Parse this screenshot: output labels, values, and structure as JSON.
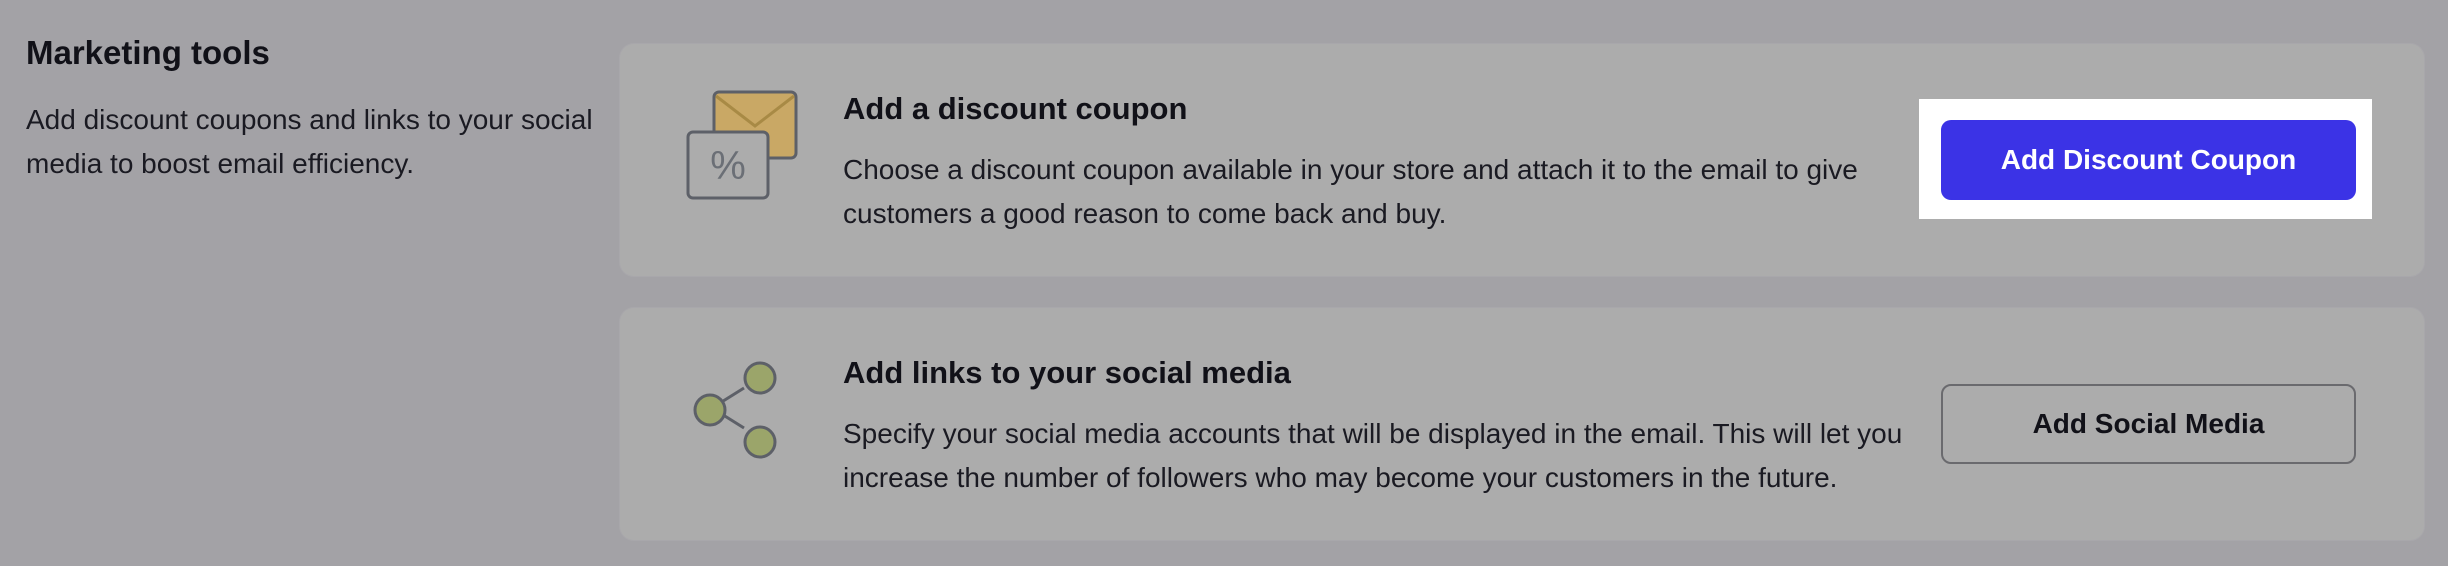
{
  "section": {
    "title": "Marketing tools",
    "description": "Add discount coupons and links to your social media to boost email efficiency."
  },
  "cards": {
    "coupon": {
      "icon": "envelope-percent-icon",
      "title": "Add a discount coupon",
      "description": "Choose a discount coupon available in your store and attach it to the email to give customers a good reason to come back and buy.",
      "button_label": "Add Discount Coupon"
    },
    "social": {
      "icon": "share-icon",
      "title": "Add links to your social media",
      "description": "Specify your social media accounts that will be displayed in the email. This will let you increase the number of followers who may become your customers in the future.",
      "button_label": "Add Social Media"
    }
  },
  "colors": {
    "overlay_background": "#a3a2a6",
    "card_background": "#acacac",
    "primary_button": "#3b33e6",
    "icon_envelope": "#c9a865",
    "icon_share_nodes": "#9ba56a"
  }
}
